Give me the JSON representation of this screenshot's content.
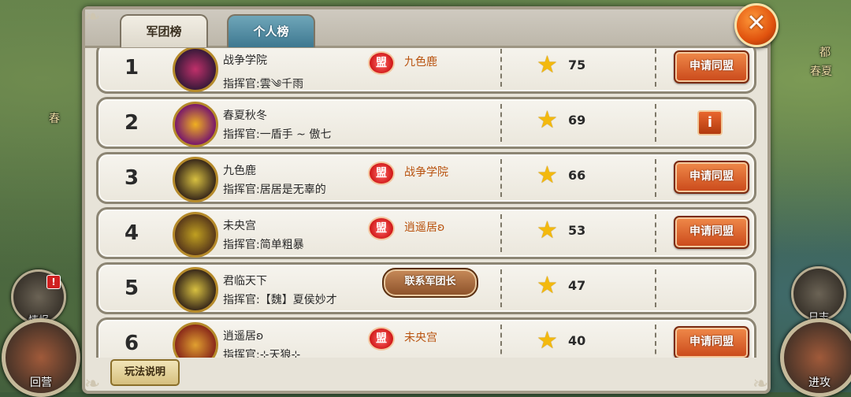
{
  "map": {
    "labels": [
      "都",
      "春夏",
      "春"
    ]
  },
  "side_buttons": {
    "intel": "情报",
    "intel_badge": "!",
    "camp": "回营",
    "daily": "日志",
    "attack": "进攻"
  },
  "tabs": [
    {
      "label": "军团榜",
      "active": true
    },
    {
      "label": "个人榜",
      "active": false
    }
  ],
  "close_label": "✕",
  "meng_label": "盟",
  "rows": [
    {
      "rank": "1",
      "name": "战争学院",
      "commander": "指挥官:雲༄千雨",
      "ally": "九色鹿",
      "score": "75",
      "action": "申请同盟",
      "emblem": "#5a2a5a"
    },
    {
      "rank": "2",
      "name": "春夏秋冬",
      "commander": "指挥官:一盾手 ~ 傲七",
      "ally": "",
      "score": "69",
      "action": "info",
      "emblem": "#6a1a6a"
    },
    {
      "rank": "3",
      "name": "九色鹿",
      "commander": "指挥官:居居是无辜的",
      "ally": "战争学院",
      "score": "66",
      "action": "申请同盟",
      "emblem": "#3a2a1a"
    },
    {
      "rank": "4",
      "name": "未央宫",
      "commander": "指挥官:简单粗暴",
      "ally": "逍遥居ʚ",
      "score": "53",
      "action": "申请同盟",
      "emblem": "#6a4a1a"
    },
    {
      "rank": "5",
      "name": "君临天下",
      "commander": "指挥官:【魏】夏侯妙才",
      "ally": "",
      "score": "47",
      "action": "",
      "emblem": "#3a2a1a"
    },
    {
      "rank": "6",
      "name": "逍遥居ʚ",
      "commander": "指挥官:⊹天狼⊹",
      "ally": "未央宫",
      "score": "40",
      "action": "申请同盟",
      "emblem": "#8a2a1a"
    }
  ],
  "contact_label": "联系军团长",
  "info_label": "i",
  "rules_label": "玩法说明",
  "colors": {
    "accent_orange": "#e0520e",
    "ally_text": "#b8520e",
    "star": "#f3b90e"
  }
}
